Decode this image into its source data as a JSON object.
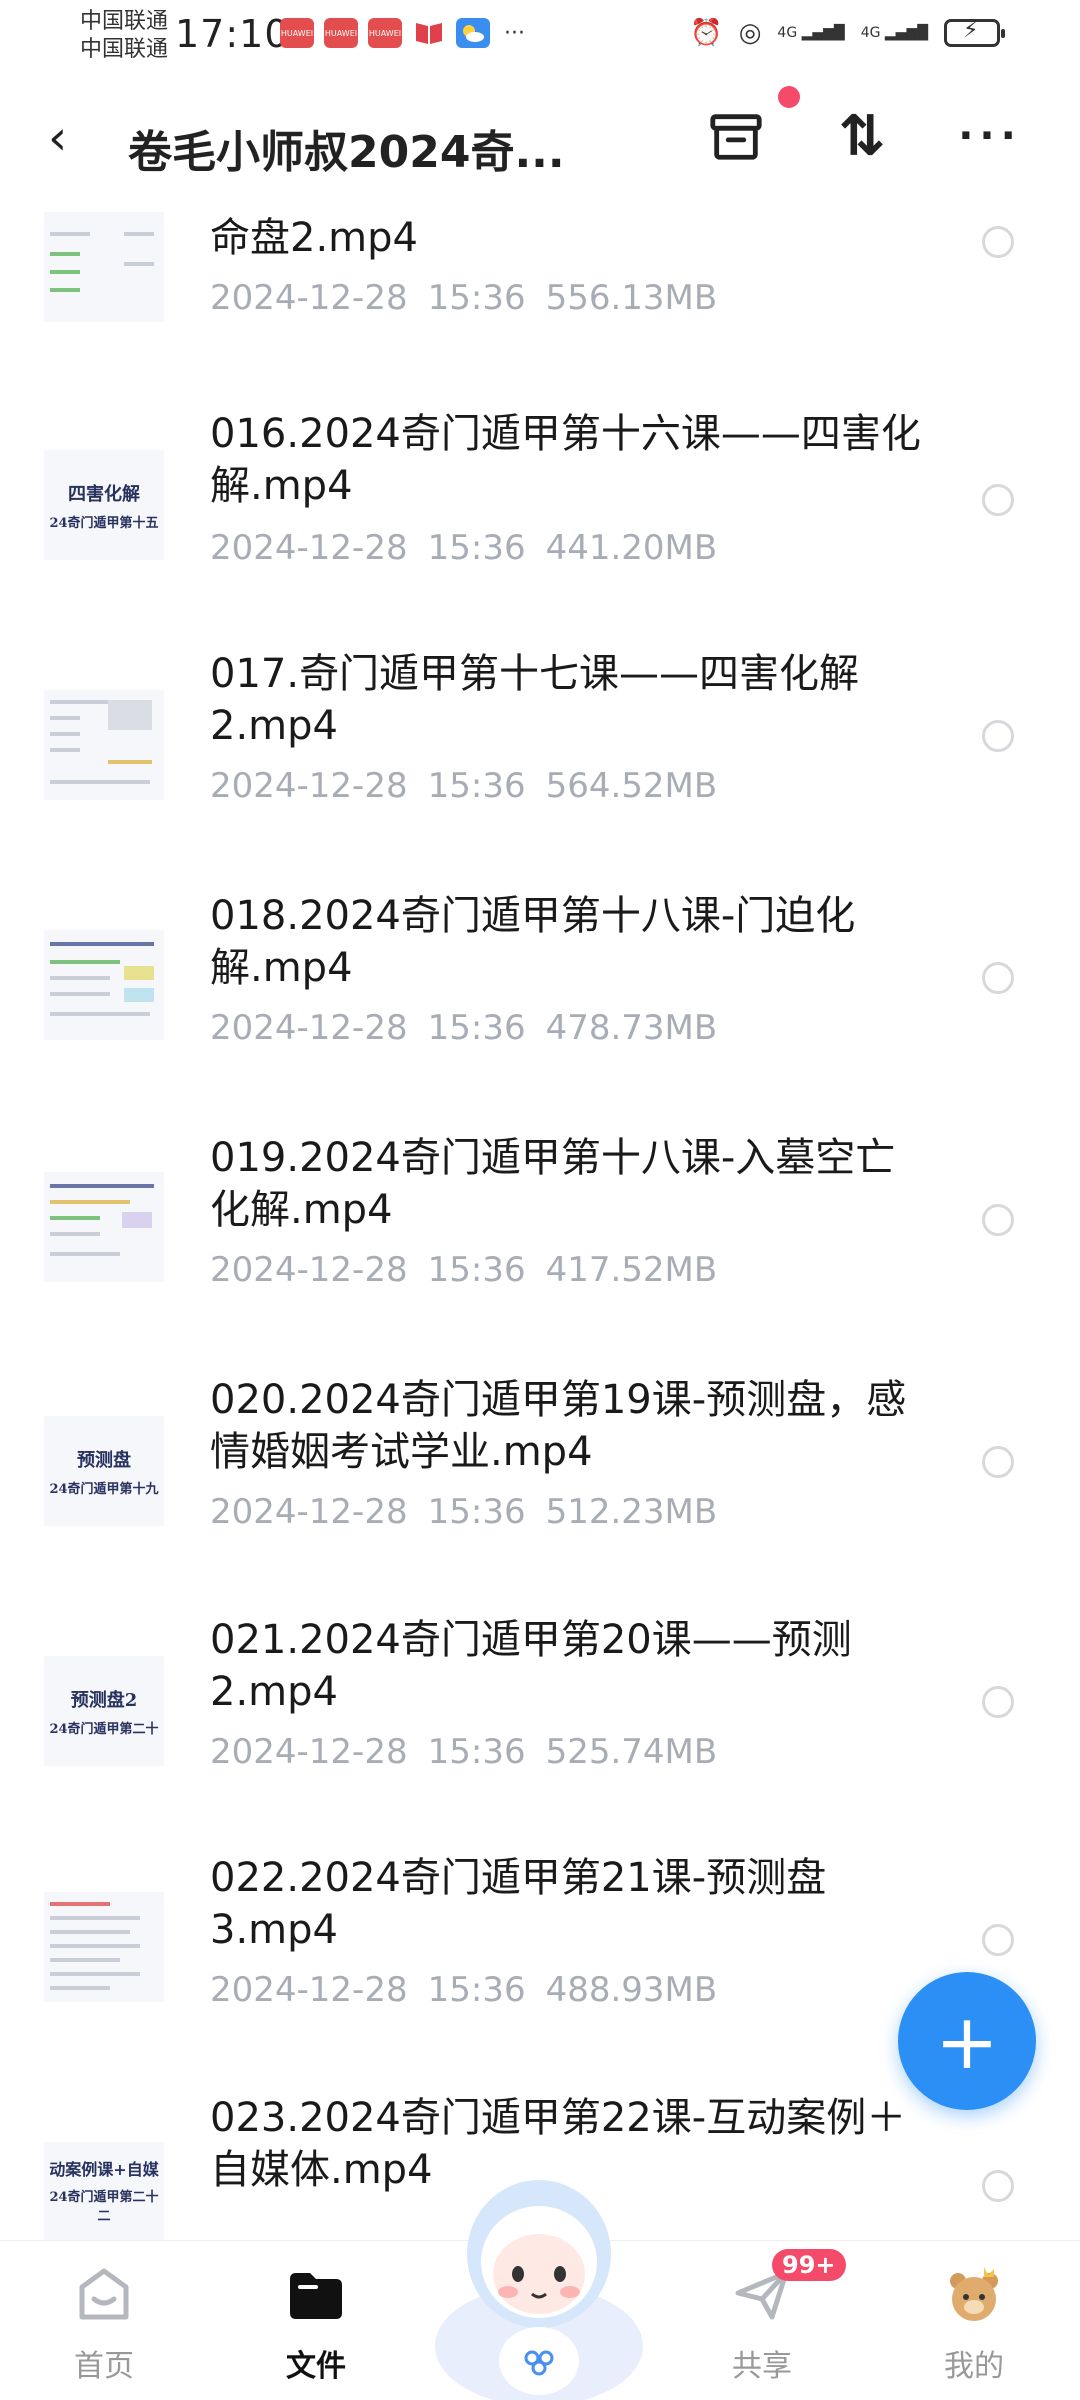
{
  "status_bar": {
    "carrier_1": "中国联通",
    "carrier_2": "中国联通",
    "time": "17:10",
    "notifications": [
      "huawei-app-icon",
      "huawei-app-icon",
      "huawei-app-icon",
      "book-icon",
      "weather-icon"
    ],
    "more": "···",
    "signal_1": "4G",
    "signal_2": "4G"
  },
  "header": {
    "back": "‹",
    "title": "卷毛小师叔2024奇...",
    "sort": "⇅",
    "more": "···"
  },
  "files": [
    {
      "name": "命盘2.mp4",
      "date": "2024-12-28",
      "time": "15:36",
      "size": "556.13MB",
      "thumb": ""
    },
    {
      "name": "016.2024奇门遁甲第十六课——四害化解.mp4",
      "date": "2024-12-28",
      "time": "15:36",
      "size": "441.20MB",
      "thumb": "四害化解",
      "thumb_sub": "24奇门遁甲第十五"
    },
    {
      "name": "017.奇门遁甲第十七课——四害化解2.mp4",
      "date": "2024-12-28",
      "time": "15:36",
      "size": "564.52MB",
      "thumb": ""
    },
    {
      "name": "018.2024奇门遁甲第十八课-门迫化解.mp4",
      "date": "2024-12-28",
      "time": "15:36",
      "size": "478.73MB",
      "thumb": ""
    },
    {
      "name": "019.2024奇门遁甲第十八课-入墓空亡化解.mp4",
      "date": "2024-12-28",
      "time": "15:36",
      "size": "417.52MB",
      "thumb": ""
    },
    {
      "name": "020.2024奇门遁甲第19课-预测盘，感情婚姻考试学业.mp4",
      "date": "2024-12-28",
      "time": "15:36",
      "size": "512.23MB",
      "thumb": "预测盘",
      "thumb_sub": "24奇门遁甲第十九"
    },
    {
      "name": "021.2024奇门遁甲第20课——预测2.mp4",
      "date": "2024-12-28",
      "time": "15:36",
      "size": "525.74MB",
      "thumb": "预测盘2",
      "thumb_sub": "24奇门遁甲第二十"
    },
    {
      "name": "022.2024奇门遁甲第21课-预测盘3.mp4",
      "date": "2024-12-28",
      "time": "15:36",
      "size": "488.93MB",
      "thumb": ""
    },
    {
      "name": "023.2024奇门遁甲第22课-互动案例＋自媒体.mp4",
      "date": "",
      "time": "",
      "size": "",
      "thumb": "动案例课+自媒",
      "thumb_sub": "24奇门遁甲第二十二"
    }
  ],
  "fab": {
    "label": "+"
  },
  "bottom_nav": {
    "home": "首页",
    "files": "文件",
    "share": "共享",
    "share_badge": "99+",
    "mine": "我的"
  },
  "colors": {
    "accent": "#2b8ff5",
    "badge": "#f54a6a",
    "meta_text": "#a8acb4"
  }
}
